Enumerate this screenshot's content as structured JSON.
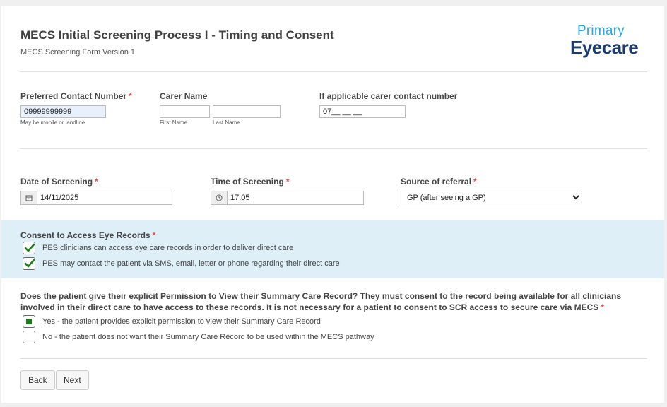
{
  "header": {
    "title": "MECS Initial Screening Process I - Timing and Consent",
    "subtitle": "MECS Screening Form Version 1",
    "logo_primary": "Primary",
    "logo_eyecare": "Eyecare"
  },
  "contact": {
    "preferred_label": "Preferred Contact Number",
    "preferred_value": "09999999999",
    "preferred_hint": "May be mobile or landline",
    "carer_label": "Carer Name",
    "first_name_hint": "First Name",
    "last_name_hint": "Last Name",
    "first_name_value": "",
    "last_name_value": "",
    "carer_number_label": "If applicable carer contact number",
    "carer_number_value": "07__ __ __"
  },
  "screening": {
    "date_label": "Date of Screening",
    "date_value": "14/11/2025",
    "time_label": "Time of Screening",
    "time_value": "17:05",
    "source_label": "Source of referral",
    "source_value": "GP (after seeing a GP)"
  },
  "consent": {
    "label": "Consent to Access Eye Records",
    "items": [
      {
        "text": "PES clinicians can access eye care records in order to deliver direct care",
        "checked": true
      },
      {
        "text": "PES may contact the patient via SMS, email, letter or phone regarding their direct care",
        "checked": true
      }
    ]
  },
  "scr": {
    "question": "Does the patient give their explicit Permission to View their Summary Care Record? They must consent to the record being available for all clinicians involved in their direct care to have access to these records. It is not necessary for a patient to consent to SCR access to secure care via MECS",
    "options": [
      {
        "text": "Yes -  the patient provides explicit permission to view their Summary Care Record",
        "selected": true
      },
      {
        "text": "No - the patient does not want their Summary Care Record to be used within the MECS pathway",
        "selected": false
      }
    ]
  },
  "required_marker": "*",
  "buttons": {
    "back": "Back",
    "next": "Next"
  },
  "colors": {
    "required": "#d9534f",
    "check": "#1a7f1a",
    "panel": "#deeff7",
    "logo_blue": "#29a8e0",
    "logo_navy": "#1a3d6b"
  }
}
